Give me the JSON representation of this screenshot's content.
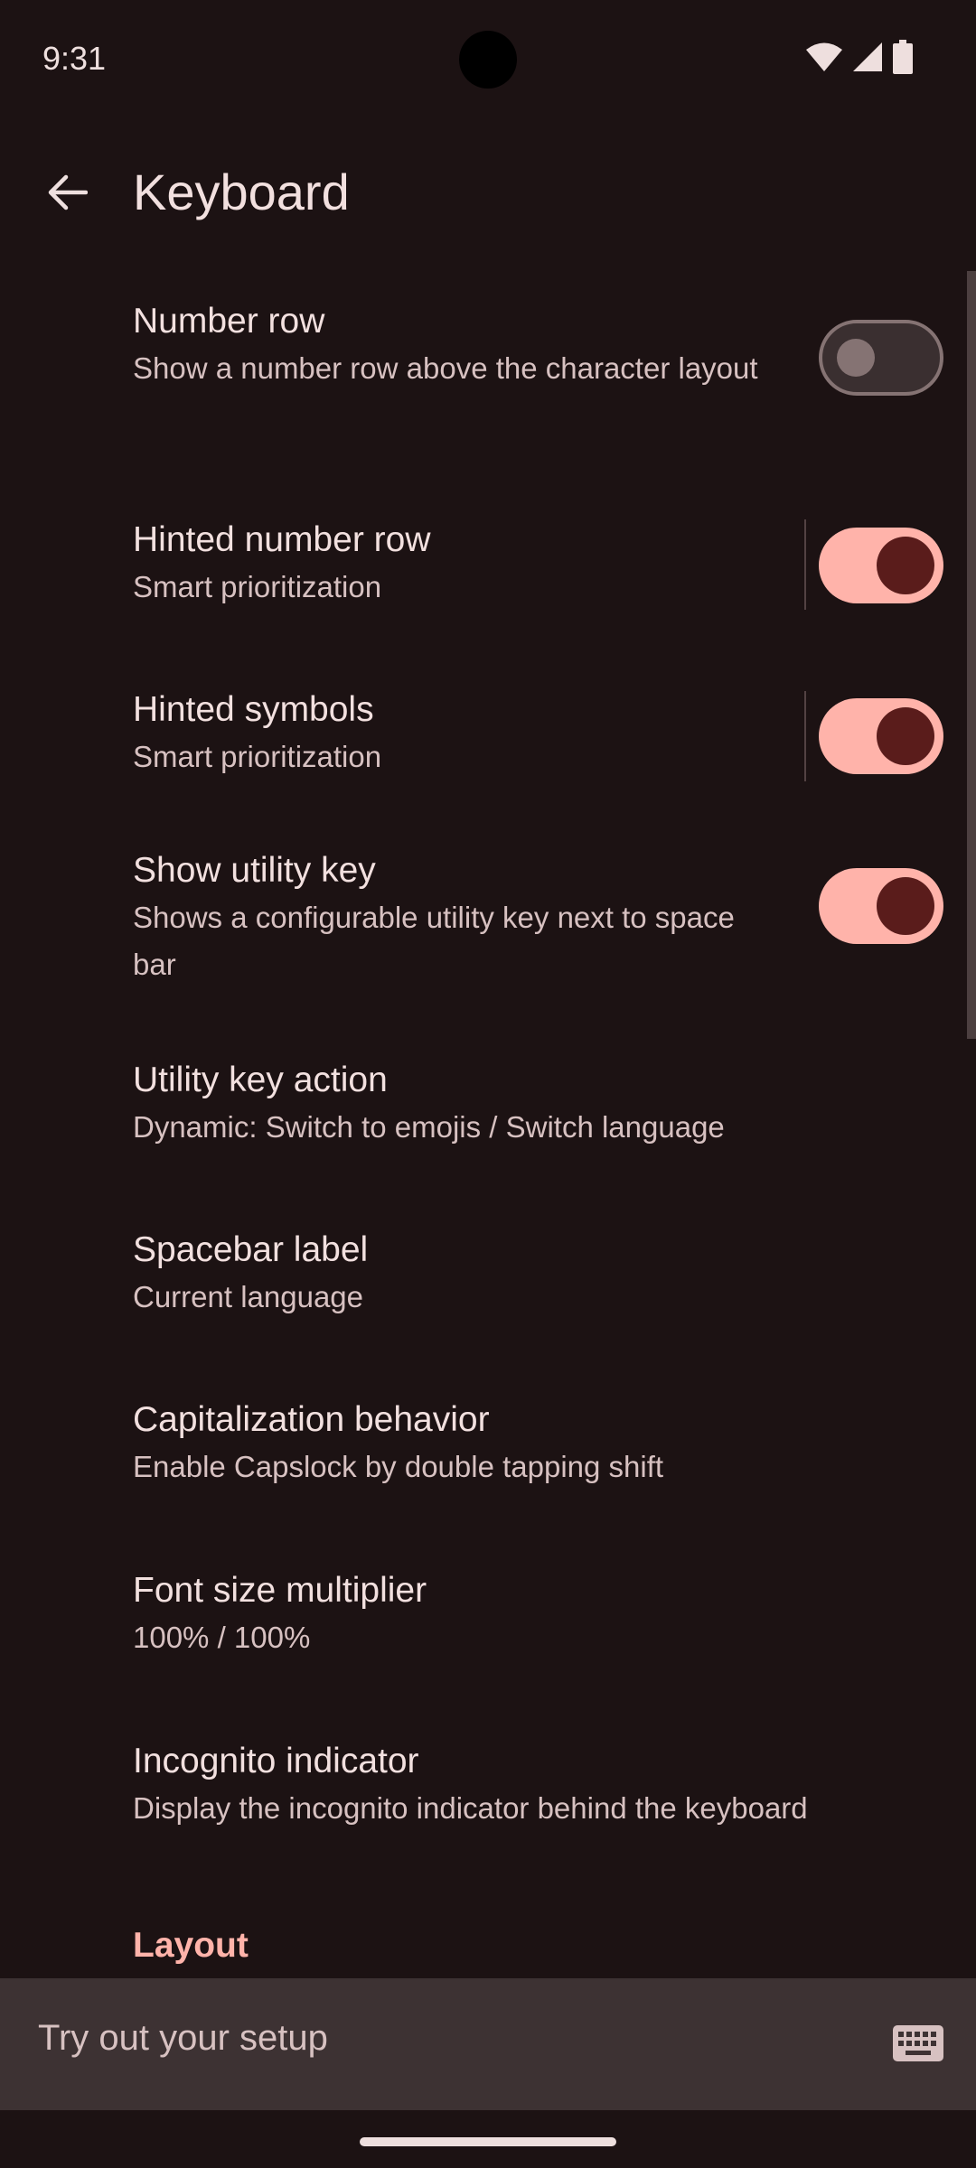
{
  "status_bar": {
    "time": "9:31",
    "icons": [
      "wifi-icon",
      "cellular-signal-icon",
      "battery-icon"
    ]
  },
  "app_bar": {
    "back_icon": "arrow-back-icon",
    "title": "Keyboard"
  },
  "settings": [
    {
      "title": "Number row",
      "subtitle": "Show a number row above the character layout",
      "toggle": "off"
    },
    {
      "title": "Hinted number row",
      "subtitle": "Smart prioritization",
      "toggle": "on",
      "divider": true
    },
    {
      "title": "Hinted symbols",
      "subtitle": "Smart prioritization",
      "toggle": "on",
      "divider": true
    },
    {
      "title": "Show utility key",
      "subtitle": "Shows a configurable utility key next to space bar",
      "toggle": "on"
    },
    {
      "title": "Utility key action",
      "subtitle": "Dynamic: Switch to emojis / Switch language"
    },
    {
      "title": "Spacebar label",
      "subtitle": "Current language"
    },
    {
      "title": "Capitalization behavior",
      "subtitle": "Enable Capslock by double tapping shift"
    },
    {
      "title": "Font size multiplier",
      "subtitle": "100% / 100%"
    },
    {
      "title": "Incognito indicator",
      "subtitle": "Display the incognito indicator behind the keyboard"
    }
  ],
  "section_header": "Layout",
  "tryout": {
    "placeholder": "Try out your setup",
    "icon": "keyboard-icon"
  },
  "colors": {
    "background": "#1c1213",
    "accent": "#ffb3aa",
    "toggle_knob_on": "#5a1c1b",
    "text_primary": "#f2e0df",
    "text_secondary": "#d7c1c1"
  }
}
